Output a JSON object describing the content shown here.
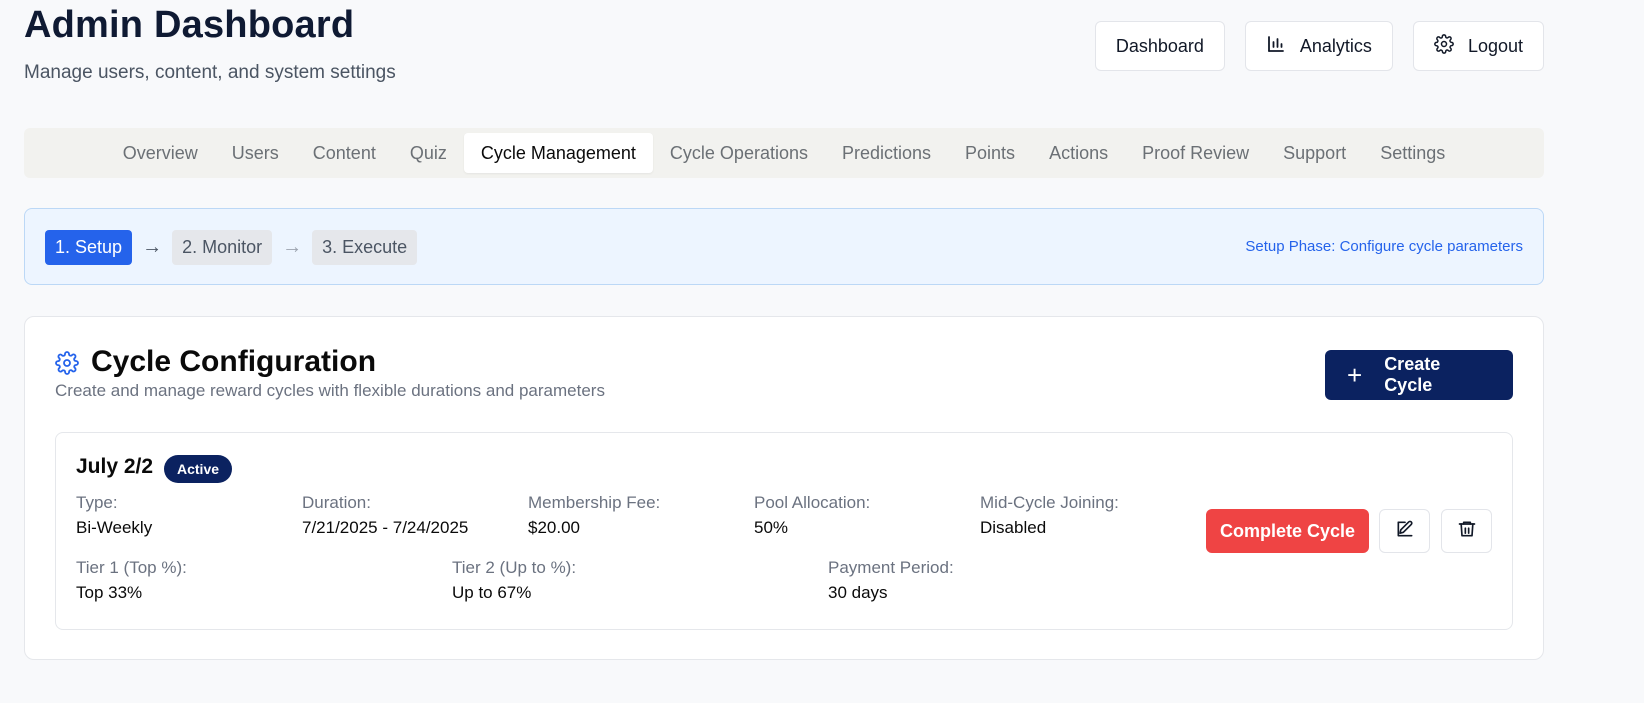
{
  "header": {
    "title": "Admin Dashboard",
    "subtitle": "Manage users, content, and system settings",
    "actions": [
      {
        "label": "Dashboard",
        "icon": ""
      },
      {
        "label": "Analytics",
        "icon": "bar-chart-icon"
      },
      {
        "label": "Logout",
        "icon": "gear-icon"
      }
    ]
  },
  "tabs": [
    {
      "label": "Overview"
    },
    {
      "label": "Users"
    },
    {
      "label": "Content"
    },
    {
      "label": "Quiz"
    },
    {
      "label": "Cycle Management",
      "active": true
    },
    {
      "label": "Cycle Operations"
    },
    {
      "label": "Predictions"
    },
    {
      "label": "Points"
    },
    {
      "label": "Actions"
    },
    {
      "label": "Proof Review"
    },
    {
      "label": "Support"
    },
    {
      "label": "Settings"
    }
  ],
  "phase": {
    "steps": [
      "1. Setup",
      "2. Monitor",
      "3. Execute"
    ],
    "active_step": 0,
    "arrow": "→",
    "note": "Setup Phase: Configure cycle parameters"
  },
  "config": {
    "icon": "gear-icon",
    "title": "Cycle Configuration",
    "description": "Create and manage reward cycles with flexible durations and parameters",
    "create_label": "Create Cycle",
    "create_icon": "plus-icon"
  },
  "cycle": {
    "name": "July 2/2",
    "status": "Active",
    "fields_row1": [
      {
        "label": "Type:",
        "value": "Bi-Weekly"
      },
      {
        "label": "Duration:",
        "value": "7/21/2025 - 7/24/2025"
      },
      {
        "label": "Membership Fee:",
        "value": "$20.00"
      },
      {
        "label": "Pool Allocation:",
        "value": "50%"
      },
      {
        "label": "Mid-Cycle Joining:",
        "value": "Disabled"
      }
    ],
    "fields_row2": [
      {
        "label": "Tier 1 (Top %):",
        "value": "Top 33%"
      },
      {
        "label": "Tier 2 (Up to %):",
        "value": "Up to 67%"
      },
      {
        "label": "Payment Period:",
        "value": "30 days"
      }
    ],
    "complete_label": "Complete Cycle",
    "edit_icon": "edit-icon",
    "delete_icon": "trash-icon"
  },
  "colors": {
    "primary_navy": "#0b2260",
    "accent_blue": "#2563eb",
    "danger": "#ef4444",
    "banner_bg": "#edf5ff"
  }
}
